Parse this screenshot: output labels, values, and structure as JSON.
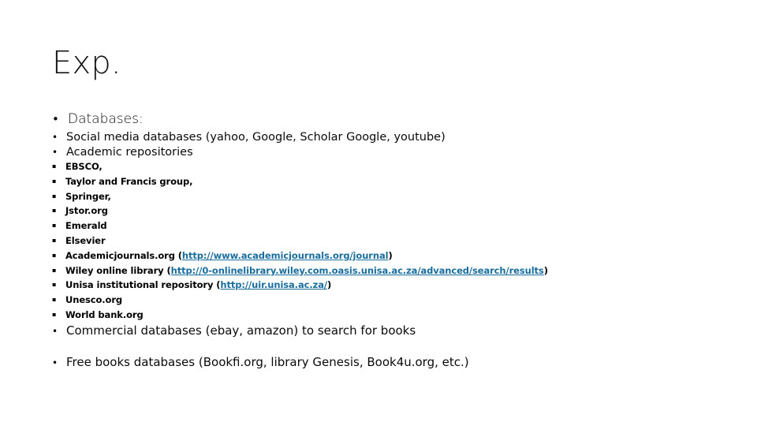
{
  "slide": {
    "title": "Exp.",
    "background_color": "#ffffff",
    "link_color": "#1a6e9e",
    "text_color": "#000000"
  },
  "markers": {
    "level1": "•",
    "level2": "•",
    "level3": "▪"
  },
  "outline": {
    "level1": {
      "label": "Databases:"
    },
    "level2": [
      {
        "label": "Social media databases (yahoo, Google, Scholar Google, youtube)"
      },
      {
        "label": "Academic repositories"
      }
    ],
    "level3": [
      {
        "text": "EBSCO,",
        "link_text": null,
        "link_prefix": null,
        "link_suffix": null
      },
      {
        "text": "Taylor and Francis group,",
        "link_text": null,
        "link_prefix": null,
        "link_suffix": null
      },
      {
        "text": "Springer,",
        "link_text": null,
        "link_prefix": null,
        "link_suffix": null
      },
      {
        "text": "Jstor.org",
        "link_text": null,
        "link_prefix": null,
        "link_suffix": null
      },
      {
        "text": "Emerald",
        "link_text": null,
        "link_prefix": null,
        "link_suffix": null
      },
      {
        "text": "Elsevier",
        "link_text": null,
        "link_prefix": null,
        "link_suffix": null
      },
      {
        "text": "Academicjournals.org",
        "link_prefix": "Academicjournals.org (",
        "link_text": "http://www.academicjournals.org/journal",
        "link_suffix": ")"
      },
      {
        "text": "Wiley online library",
        "link_prefix": "Wiley online library (",
        "link_text": "http://0-onlinelibrary.wiley.com.oasis.unisa.ac.za/advanced/search/results",
        "link_suffix": ")"
      },
      {
        "text": "Unisa institutional repository",
        "link_prefix": "Unisa institutional repository (",
        "link_text": "http://uir.unisa.ac.za/",
        "link_suffix": ")"
      },
      {
        "text": "Unesco.org",
        "link_text": null,
        "link_prefix": null,
        "link_suffix": null
      },
      {
        "text": "World bank.org",
        "link_text": null,
        "link_prefix": null,
        "link_suffix": null
      }
    ],
    "level2_trailing": [
      {
        "label": "Commercial databases (ebay, amazon) to search for books"
      },
      {
        "label": "Free books databases (Bookfi.org, library Genesis, Book4u.org, etc.)"
      }
    ]
  }
}
